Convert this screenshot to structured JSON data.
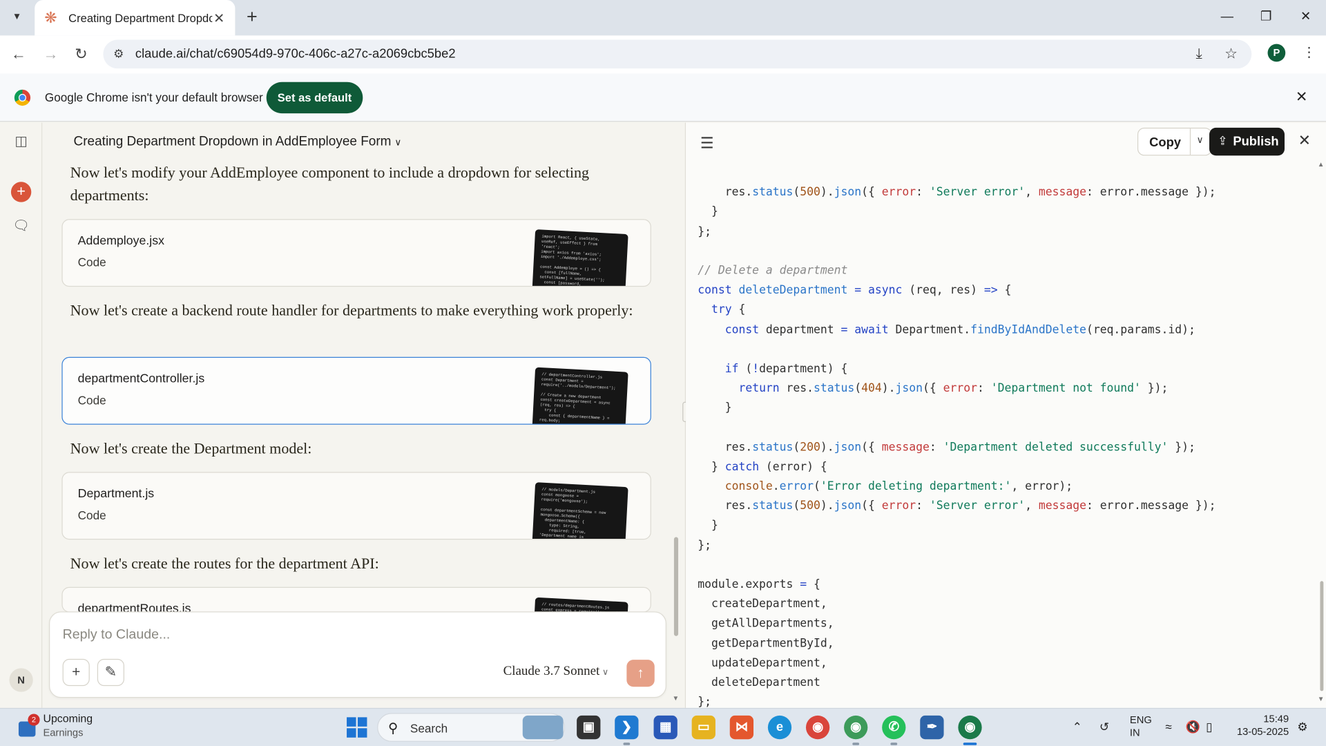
{
  "browser": {
    "tab_title": "Creating Department Dropdow",
    "url": "claude.ai/chat/c69054d9-970c-406c-a27c-a2069cbc5be2",
    "profile_initial": "P",
    "infobar_text": "Google Chrome isn't your default browser",
    "set_default_label": "Set as default"
  },
  "sidebar": {
    "user_initial": "N"
  },
  "chat": {
    "title": "Creating Department Dropdown in AddEmployee Form",
    "messages": [
      "Now let's modify your AddEmployee component to include a dropdown for selecting departments:",
      "Now let's create a backend route handler for departments to make everything work properly:",
      "Now let's create the Department model:",
      "Now let's create the routes for the department API:"
    ],
    "artifacts": [
      {
        "name": "Addemploye.jsx",
        "type": "Code",
        "preview": "import React, { useState,\nuseRef, useEffect } from\n'react';\nimport axios from 'axios';\nimport './Addemploye.css';\n\nconst Addemploye = () => {\n  const [fullName,\nsetFullName] = useState('');\n  const [password,"
      },
      {
        "name": "departmentController.js",
        "type": "Code",
        "preview": "// departmentController.js\nconst Department =\nrequire('../models/Department');\n\n// Create a new department\nconst createDepartment = async\n(req, res) => {\n  try {\n    const { departmentName } =\nreq.body;"
      },
      {
        "name": "Department.js",
        "type": "Code",
        "preview": "// models/Department.js\nconst mongoose =\nrequire('mongoose');\n\nconst departmentSchema = new\nmongoose.Schema({\n  departmentName: {\n    type: String,\n    required: [true,\n'Department name is"
      },
      {
        "name": "departmentRoutes.js",
        "type": "Code",
        "preview": "// routes/departmentRoutes.js\nconst express = require('express');"
      }
    ],
    "composer_placeholder": "Reply to Claude...",
    "model_label": "Claude 3.7 Sonnet"
  },
  "artifact_panel": {
    "copy_label": "Copy",
    "publish_label": "Publish"
  },
  "taskbar": {
    "widget_title": "Upcoming",
    "widget_subtitle": "Earnings",
    "widget_badge": "2",
    "search_label": "Search",
    "lang_line1": "ENG",
    "lang_line2": "IN",
    "time": "15:49",
    "date": "13-05-2025"
  }
}
